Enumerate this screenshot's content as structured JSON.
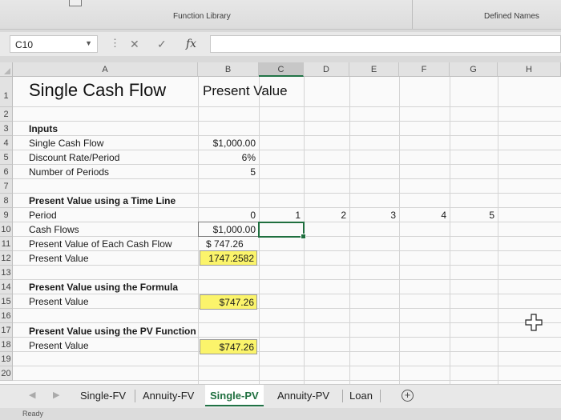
{
  "ribbon": {
    "groups": [
      "Function Library",
      "Defined Names"
    ]
  },
  "formula_bar": {
    "name_box": "C10",
    "cancel_icon": "✕",
    "enter_icon": "✓",
    "fx_label": "fx",
    "formula": ""
  },
  "columns": [
    "A",
    "B",
    "C",
    "D",
    "E",
    "F",
    "G",
    "H"
  ],
  "active_column": "C",
  "rows": [
    "1",
    "2",
    "3",
    "4",
    "5",
    "6",
    "7",
    "8",
    "9",
    "10",
    "11",
    "12",
    "13",
    "14",
    "15",
    "16",
    "17",
    "18",
    "19",
    "20"
  ],
  "cells": {
    "a1": "Single Cash Flow",
    "b1": "Present Value",
    "a3": "Inputs",
    "a4": "Single Cash Flow",
    "b4": "$1,000.00",
    "a5": "Discount Rate/Period",
    "b5": "6%",
    "a6": "Number of Periods",
    "b6": "5",
    "a8": "Present Value using a Time Line",
    "a9": "Period",
    "b9": "0",
    "c9": "1",
    "d9": "2",
    "e9": "3",
    "f9": "4",
    "g9": "5",
    "a10": "Cash Flows",
    "b10": "$1,000.00",
    "a11": "Present Value of Each Cash Flow",
    "b11": "$  747.26",
    "a12": "Present Value",
    "b12": "1747.2582",
    "a14": "Present Value using the Formula",
    "a15": "Present Value",
    "b15": "$747.26",
    "a17": "Present Value using the PV Function",
    "a18": "Present Value",
    "b18": "$747.26"
  },
  "highlight_color": "#fbf46b",
  "sheets": [
    "Single-FV",
    "Annuity-FV",
    "Single-PV",
    "Annuity-PV",
    "Loan"
  ],
  "active_sheet": "Single-PV",
  "add_sheet_icon": "+",
  "status": "Ready"
}
